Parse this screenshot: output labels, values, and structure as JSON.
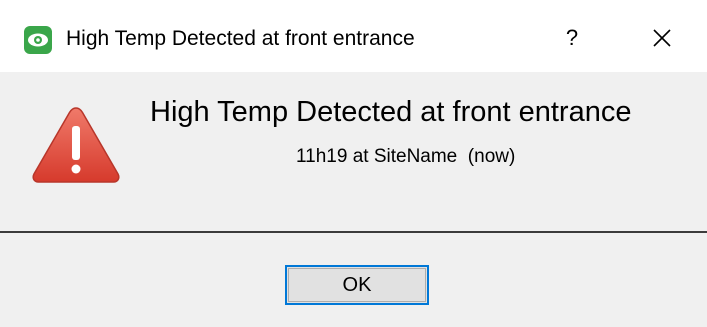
{
  "window": {
    "title": "High Temp Detected at front entrance",
    "app_icon": "eye-app-icon",
    "help_label": "?",
    "close_icon": "close-icon"
  },
  "message": {
    "icon": "warning-icon",
    "heading": "High Temp Detected at front entrance",
    "detail": "11h19 at SiteName  (now)"
  },
  "buttons": {
    "ok_label": "OK"
  },
  "colors": {
    "titlebar_bg": "#ffffff",
    "dialog_bg": "#f0f0f0",
    "warning_red": "#e04b3c",
    "button_focus_border": "#0078d7",
    "app_icon_green": "#3aa64a"
  }
}
